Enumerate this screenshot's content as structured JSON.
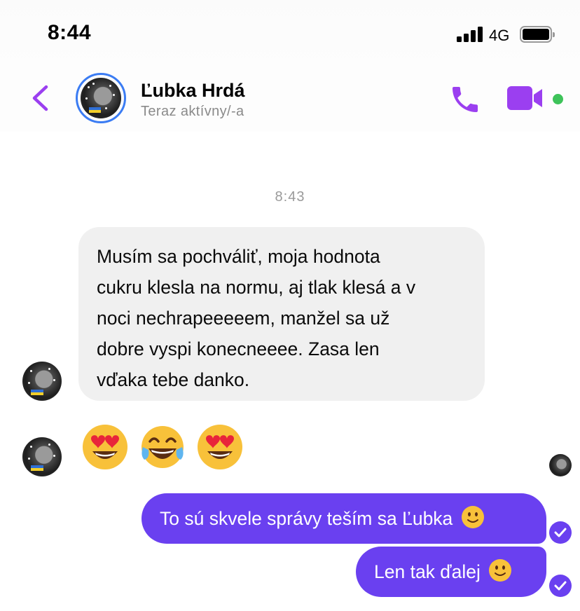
{
  "status_bar": {
    "time": "8:44",
    "network": "4G"
  },
  "header": {
    "contact_name": "Ľubka Hrdá",
    "contact_status": "Teraz aktívny/-a",
    "online_color": "#3ec35a",
    "accent_color": "#9b3ff0"
  },
  "conversation": {
    "timestamp": "8:43",
    "incoming_message": "Musím sa pochváliť, moja hodnota\ncukru klesla na normu, aj tlak klesá a v\nnoci nechrapeeeeem, manžel sa už\ndobre vyspi konecneeee. Zasa len\nvďaka tebe danko.",
    "incoming_emojis": [
      "heart-eyes",
      "tears-of-joy",
      "heart-eyes"
    ],
    "outgoing_messages": [
      {
        "text": "To sú skvele správy teším sa Ľubka",
        "emoji": "slightly-smiling"
      },
      {
        "text": "Len tak ďalej",
        "emoji": "slightly-smiling"
      }
    ],
    "outgoing_color": "#6a40f0",
    "incoming_bubble_color": "#f0f0f0"
  }
}
